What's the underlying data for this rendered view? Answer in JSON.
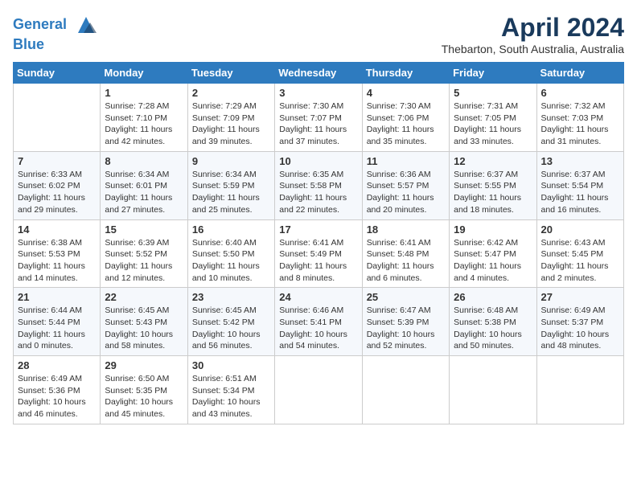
{
  "header": {
    "logo_line1": "General",
    "logo_line2": "Blue",
    "month": "April 2024",
    "location": "Thebarton, South Australia, Australia"
  },
  "days_of_week": [
    "Sunday",
    "Monday",
    "Tuesday",
    "Wednesday",
    "Thursday",
    "Friday",
    "Saturday"
  ],
  "weeks": [
    [
      {
        "day": "",
        "info": ""
      },
      {
        "day": "1",
        "info": "Sunrise: 7:28 AM\nSunset: 7:10 PM\nDaylight: 11 hours\nand 42 minutes."
      },
      {
        "day": "2",
        "info": "Sunrise: 7:29 AM\nSunset: 7:09 PM\nDaylight: 11 hours\nand 39 minutes."
      },
      {
        "day": "3",
        "info": "Sunrise: 7:30 AM\nSunset: 7:07 PM\nDaylight: 11 hours\nand 37 minutes."
      },
      {
        "day": "4",
        "info": "Sunrise: 7:30 AM\nSunset: 7:06 PM\nDaylight: 11 hours\nand 35 minutes."
      },
      {
        "day": "5",
        "info": "Sunrise: 7:31 AM\nSunset: 7:05 PM\nDaylight: 11 hours\nand 33 minutes."
      },
      {
        "day": "6",
        "info": "Sunrise: 7:32 AM\nSunset: 7:03 PM\nDaylight: 11 hours\nand 31 minutes."
      }
    ],
    [
      {
        "day": "7",
        "info": "Sunrise: 6:33 AM\nSunset: 6:02 PM\nDaylight: 11 hours\nand 29 minutes."
      },
      {
        "day": "8",
        "info": "Sunrise: 6:34 AM\nSunset: 6:01 PM\nDaylight: 11 hours\nand 27 minutes."
      },
      {
        "day": "9",
        "info": "Sunrise: 6:34 AM\nSunset: 5:59 PM\nDaylight: 11 hours\nand 25 minutes."
      },
      {
        "day": "10",
        "info": "Sunrise: 6:35 AM\nSunset: 5:58 PM\nDaylight: 11 hours\nand 22 minutes."
      },
      {
        "day": "11",
        "info": "Sunrise: 6:36 AM\nSunset: 5:57 PM\nDaylight: 11 hours\nand 20 minutes."
      },
      {
        "day": "12",
        "info": "Sunrise: 6:37 AM\nSunset: 5:55 PM\nDaylight: 11 hours\nand 18 minutes."
      },
      {
        "day": "13",
        "info": "Sunrise: 6:37 AM\nSunset: 5:54 PM\nDaylight: 11 hours\nand 16 minutes."
      }
    ],
    [
      {
        "day": "14",
        "info": "Sunrise: 6:38 AM\nSunset: 5:53 PM\nDaylight: 11 hours\nand 14 minutes."
      },
      {
        "day": "15",
        "info": "Sunrise: 6:39 AM\nSunset: 5:52 PM\nDaylight: 11 hours\nand 12 minutes."
      },
      {
        "day": "16",
        "info": "Sunrise: 6:40 AM\nSunset: 5:50 PM\nDaylight: 11 hours\nand 10 minutes."
      },
      {
        "day": "17",
        "info": "Sunrise: 6:41 AM\nSunset: 5:49 PM\nDaylight: 11 hours\nand 8 minutes."
      },
      {
        "day": "18",
        "info": "Sunrise: 6:41 AM\nSunset: 5:48 PM\nDaylight: 11 hours\nand 6 minutes."
      },
      {
        "day": "19",
        "info": "Sunrise: 6:42 AM\nSunset: 5:47 PM\nDaylight: 11 hours\nand 4 minutes."
      },
      {
        "day": "20",
        "info": "Sunrise: 6:43 AM\nSunset: 5:45 PM\nDaylight: 11 hours\nand 2 minutes."
      }
    ],
    [
      {
        "day": "21",
        "info": "Sunrise: 6:44 AM\nSunset: 5:44 PM\nDaylight: 11 hours\nand 0 minutes."
      },
      {
        "day": "22",
        "info": "Sunrise: 6:45 AM\nSunset: 5:43 PM\nDaylight: 10 hours\nand 58 minutes."
      },
      {
        "day": "23",
        "info": "Sunrise: 6:45 AM\nSunset: 5:42 PM\nDaylight: 10 hours\nand 56 minutes."
      },
      {
        "day": "24",
        "info": "Sunrise: 6:46 AM\nSunset: 5:41 PM\nDaylight: 10 hours\nand 54 minutes."
      },
      {
        "day": "25",
        "info": "Sunrise: 6:47 AM\nSunset: 5:39 PM\nDaylight: 10 hours\nand 52 minutes."
      },
      {
        "day": "26",
        "info": "Sunrise: 6:48 AM\nSunset: 5:38 PM\nDaylight: 10 hours\nand 50 minutes."
      },
      {
        "day": "27",
        "info": "Sunrise: 6:49 AM\nSunset: 5:37 PM\nDaylight: 10 hours\nand 48 minutes."
      }
    ],
    [
      {
        "day": "28",
        "info": "Sunrise: 6:49 AM\nSunset: 5:36 PM\nDaylight: 10 hours\nand 46 minutes."
      },
      {
        "day": "29",
        "info": "Sunrise: 6:50 AM\nSunset: 5:35 PM\nDaylight: 10 hours\nand 45 minutes."
      },
      {
        "day": "30",
        "info": "Sunrise: 6:51 AM\nSunset: 5:34 PM\nDaylight: 10 hours\nand 43 minutes."
      },
      {
        "day": "",
        "info": ""
      },
      {
        "day": "",
        "info": ""
      },
      {
        "day": "",
        "info": ""
      },
      {
        "day": "",
        "info": ""
      }
    ]
  ]
}
